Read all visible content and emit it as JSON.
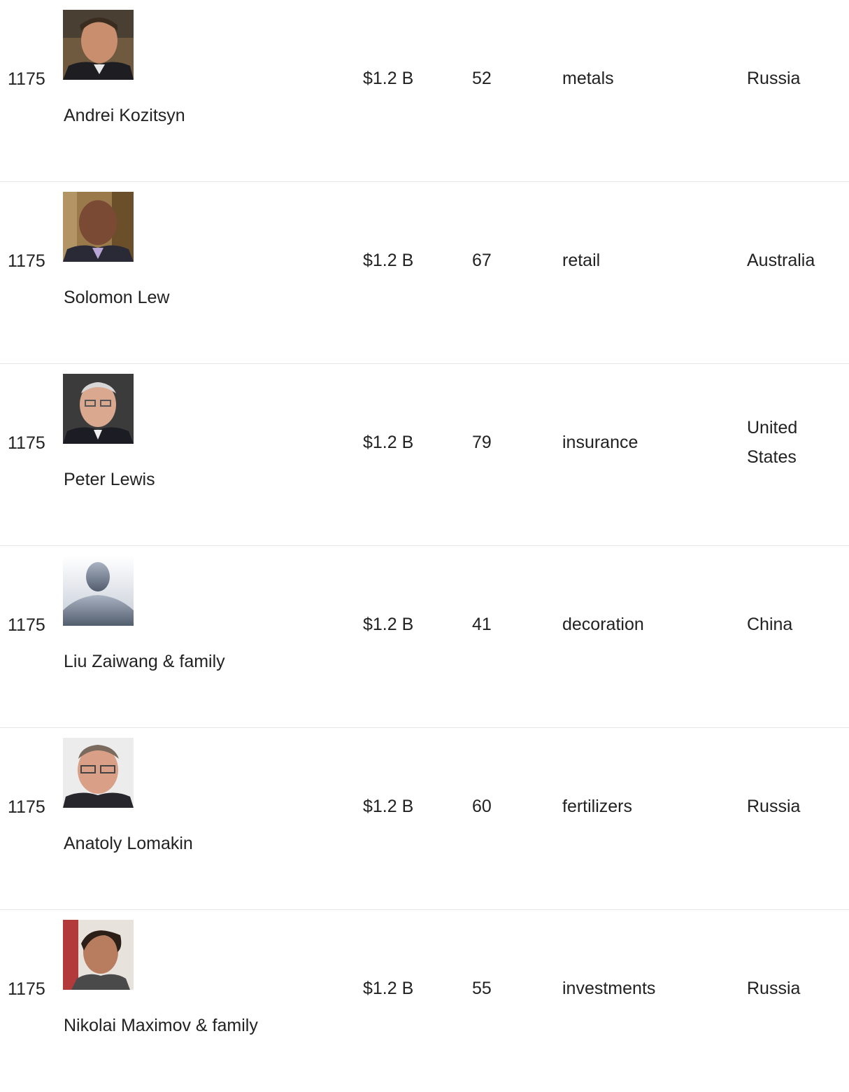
{
  "rows": [
    {
      "rank": "1175",
      "name": "Andrei Kozitsyn",
      "net_worth": "$1.2 B",
      "age": "52",
      "industry": "metals",
      "country": "Russia",
      "photo": "portrait-photo"
    },
    {
      "rank": "1175",
      "name": "Solomon Lew",
      "net_worth": "$1.2 B",
      "age": "67",
      "industry": "retail",
      "country": "Australia",
      "photo": "portrait-photo"
    },
    {
      "rank": "1175",
      "name": "Peter Lewis",
      "net_worth": "$1.2 B",
      "age": "79",
      "industry": "insurance",
      "country": "United States",
      "photo": "portrait-photo"
    },
    {
      "rank": "1175",
      "name": "Liu Zaiwang & family",
      "net_worth": "$1.2 B",
      "age": "41",
      "industry": "decoration",
      "country": "China",
      "photo": "placeholder-silhouette"
    },
    {
      "rank": "1175",
      "name": "Anatoly Lomakin",
      "net_worth": "$1.2 B",
      "age": "60",
      "industry": "fertilizers",
      "country": "Russia",
      "photo": "portrait-photo"
    },
    {
      "rank": "1175",
      "name": "Nikolai Maximov & family",
      "net_worth": "$1.2 B",
      "age": "55",
      "industry": "investments",
      "country": "Russia",
      "photo": "portrait-photo"
    }
  ]
}
